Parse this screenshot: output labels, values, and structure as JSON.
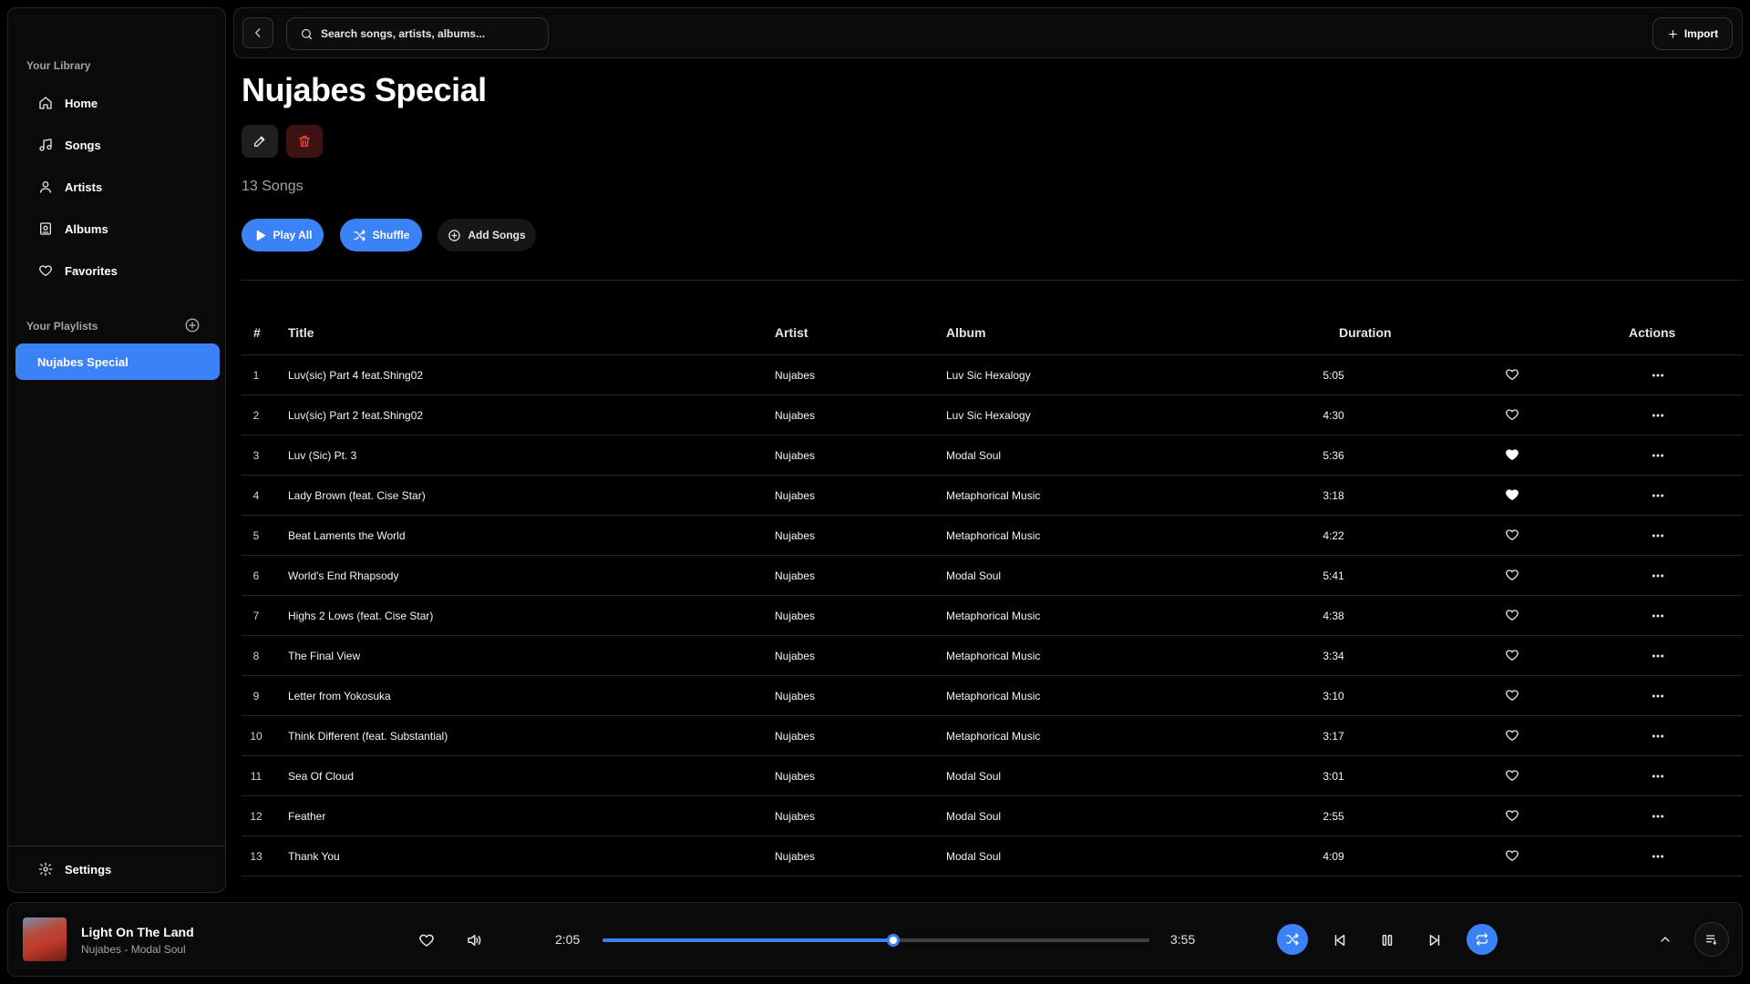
{
  "sidebar": {
    "library_heading": "Your Library",
    "nav": [
      {
        "label": "Home",
        "icon": "home-icon"
      },
      {
        "label": "Songs",
        "icon": "music-note-icon"
      },
      {
        "label": "Artists",
        "icon": "user-icon"
      },
      {
        "label": "Albums",
        "icon": "album-icon"
      },
      {
        "label": "Favorites",
        "icon": "heart-icon"
      }
    ],
    "playlists_heading": "Your Playlists",
    "playlists": [
      {
        "label": "Nujabes Special",
        "active": true
      }
    ],
    "settings_label": "Settings"
  },
  "topbar": {
    "search_placeholder": "Search songs, artists, albums...",
    "import_label": "Import"
  },
  "playlist": {
    "title": "Nujabes Special",
    "song_count": "13 Songs",
    "play_all_label": "Play All",
    "shuffle_label": "Shuffle",
    "add_songs_label": "Add Songs"
  },
  "table": {
    "headers": {
      "num": "#",
      "title": "Title",
      "artist": "Artist",
      "album": "Album",
      "duration": "Duration",
      "actions": "Actions"
    },
    "rows": [
      {
        "num": "1",
        "title": "Luv(sic) Part 4 feat.Shing02",
        "artist": "Nujabes",
        "album": "Luv Sic Hexalogy",
        "duration": "5:05",
        "favorite": false
      },
      {
        "num": "2",
        "title": "Luv(sic) Part 2 feat.Shing02",
        "artist": "Nujabes",
        "album": "Luv Sic Hexalogy",
        "duration": "4:30",
        "favorite": false
      },
      {
        "num": "3",
        "title": "Luv (Sic) Pt. 3",
        "artist": "Nujabes",
        "album": "Modal Soul",
        "duration": "5:36",
        "favorite": true
      },
      {
        "num": "4",
        "title": "Lady Brown (feat. Cise Star)",
        "artist": "Nujabes",
        "album": "Metaphorical Music",
        "duration": "3:18",
        "favorite": true
      },
      {
        "num": "5",
        "title": "Beat Laments the World",
        "artist": "Nujabes",
        "album": "Metaphorical Music",
        "duration": "4:22",
        "favorite": false
      },
      {
        "num": "6",
        "title": "World's End Rhapsody",
        "artist": "Nujabes",
        "album": "Modal Soul",
        "duration": "5:41",
        "favorite": false
      },
      {
        "num": "7",
        "title": "Highs 2 Lows (feat. Cise Star)",
        "artist": "Nujabes",
        "album": "Metaphorical Music",
        "duration": "4:38",
        "favorite": false
      },
      {
        "num": "8",
        "title": "The Final View",
        "artist": "Nujabes",
        "album": "Metaphorical Music",
        "duration": "3:34",
        "favorite": false
      },
      {
        "num": "9",
        "title": "Letter from Yokosuka",
        "artist": "Nujabes",
        "album": "Metaphorical Music",
        "duration": "3:10",
        "favorite": false
      },
      {
        "num": "10",
        "title": "Think Different (feat. Substantial)",
        "artist": "Nujabes",
        "album": "Metaphorical Music",
        "duration": "3:17",
        "favorite": false
      },
      {
        "num": "11",
        "title": "Sea Of Cloud",
        "artist": "Nujabes",
        "album": "Modal Soul",
        "duration": "3:01",
        "favorite": false
      },
      {
        "num": "12",
        "title": "Feather",
        "artist": "Nujabes",
        "album": "Modal Soul",
        "duration": "2:55",
        "favorite": false
      },
      {
        "num": "13",
        "title": "Thank You",
        "artist": "Nujabes",
        "album": "Modal Soul",
        "duration": "4:09",
        "favorite": false
      }
    ]
  },
  "player": {
    "track_title": "Light On The Land",
    "track_subtitle": "Nujabes - Modal Soul",
    "current_time": "2:05",
    "total_time": "3:55",
    "progress_fraction": 0.532,
    "shuffle_on": true,
    "repeat_on": true
  },
  "colors": {
    "accent": "#3b82f6",
    "danger": "#ef4444",
    "background": "#000000",
    "panel": "#0a0a0a"
  }
}
